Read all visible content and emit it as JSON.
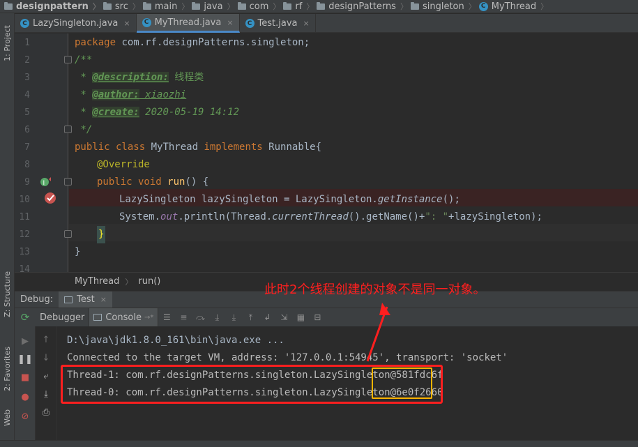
{
  "navbar": {
    "items": [
      "designpattern",
      "src",
      "main",
      "java",
      "com",
      "rf",
      "designPatterns",
      "singleton",
      "MyThread"
    ]
  },
  "left_strip": {
    "project": "1: Project",
    "structure": "Z: Structure",
    "favorites": "2: Favorites",
    "web": "Web"
  },
  "tabs": [
    {
      "label": "LazySingleton.java",
      "close": "×"
    },
    {
      "label": "MyThread.java",
      "close": "×"
    },
    {
      "label": "Test.java",
      "close": "×"
    }
  ],
  "editor": {
    "line_numbers": [
      "1",
      "2",
      "3",
      "4",
      "5",
      "6",
      "7",
      "8",
      "9",
      "10",
      "11",
      "12",
      "13",
      "14"
    ],
    "l1": {
      "kw": "package",
      "rest": " com.rf.designPatterns.singleton;"
    },
    "l2": "/**",
    "l3": {
      "star": " * ",
      "tag": "@description:",
      "text": " 线程类"
    },
    "l4": {
      "star": " * ",
      "tag": "@author:",
      "text": " xiaozhi"
    },
    "l5": {
      "star": " * ",
      "tag": "@create:",
      "text": " 2020-05-19 14:12"
    },
    "l6": " */",
    "l7": {
      "kw1": "public class",
      "name": " MyThread ",
      "kw2": "implements",
      "rest": " Runnable{"
    },
    "l8": "@Override",
    "l9": {
      "kw": "public void",
      "fn": " run",
      "rest": "() {"
    },
    "l10": {
      "a": "LazySingleton lazySingleton = LazySingleton.",
      "b": "getInstance",
      "c": "();"
    },
    "l11": {
      "a": "System.",
      "b": "out",
      "c": ".println(Thread.",
      "d": "currentThread",
      "e": "().getName()+",
      "f": "\": \"",
      "g": "+lazySingleton);"
    },
    "l12": "}",
    "l13": "}"
  },
  "editor_breadcrumb": {
    "cls": "MyThread",
    "method": "run()"
  },
  "debug": {
    "title": "Debug:",
    "run_tab": "Test",
    "debugger_tab": "Debugger",
    "console_tab": "Console"
  },
  "console": {
    "lines": [
      "D:\\java\\jdk1.8.0_161\\bin\\java.exe ...",
      "Connected to the target VM, address: '127.0.0.1:54945', transport: 'socket'",
      "Thread-1: com.rf.designPatterns.singleton.LazySingleton@581fdc6f",
      "Thread-0: com.rf.designPatterns.singleton.LazySingleton@6e0f2660"
    ]
  },
  "annotation": {
    "text": "此时2个线程创建的对象不是同一对象。",
    "color": "#ff1f1f"
  },
  "colors": {
    "background": "#2b2b2b",
    "panel": "#3c3f41",
    "keyword": "#cc7832",
    "comment": "#629755",
    "accent": "#4a88c7",
    "highlight_box": "#ffb400"
  }
}
